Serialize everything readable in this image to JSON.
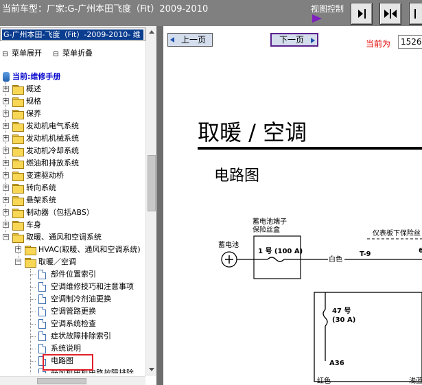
{
  "header": {
    "car_model": "当前车型：厂家:G-广州本田飞度（Fit）2009-2010",
    "view_control_label": "视图控制"
  },
  "left_panel": {
    "title": "G-广州本田-飞度（Fit）-2009-2010- 维",
    "expand_all": "菜单展开",
    "collapse_all": "菜单折叠",
    "root": "当前:维修手册",
    "tree": [
      "概述",
      "规格",
      "保养",
      "发动机电气系统",
      "发动机机械系统",
      "发动机冷却系统",
      "燃油和排放系统",
      "变速驱动桥",
      "转向系统",
      "悬架系统",
      "制动器（包括ABS）",
      "车身",
      "取暖、通风和空调系统"
    ],
    "hvac_sub": "HVAC(取暖、通风和空调系统)",
    "ac_folder": "取暖／空调",
    "ac_docs": [
      "部件位置索引",
      "空调维修技巧和注意事项",
      "空调制冷剂油更换",
      "空调管路更换",
      "空调系统检查",
      "症状故障排除索引",
      "系统说明",
      "电路图",
      "鼓风机电机电路故障排除"
    ]
  },
  "nav": {
    "prev": "上一页",
    "next": "下一页",
    "current_label": "当前为",
    "current_page": "1526"
  },
  "document": {
    "title": "取暖 / 空调",
    "subtitle": "电路图",
    "labels": {
      "fuse_box": "蓄电池端子\n保险丝盒",
      "fuse_box_l1": "蓄电池端子",
      "fuse_box_l2": "保险丝盒",
      "dash_box": "仪表板下保险丝",
      "battery": "蓄电池",
      "fuse1": "1 号 (100 A)",
      "wire_white": "白色",
      "t9": "T-9",
      "six": "6",
      "fuse47a": "47 号",
      "fuse47b": "(30 A)",
      "a36": "A36",
      "red": "红色",
      "light": "浅蓝"
    }
  }
}
